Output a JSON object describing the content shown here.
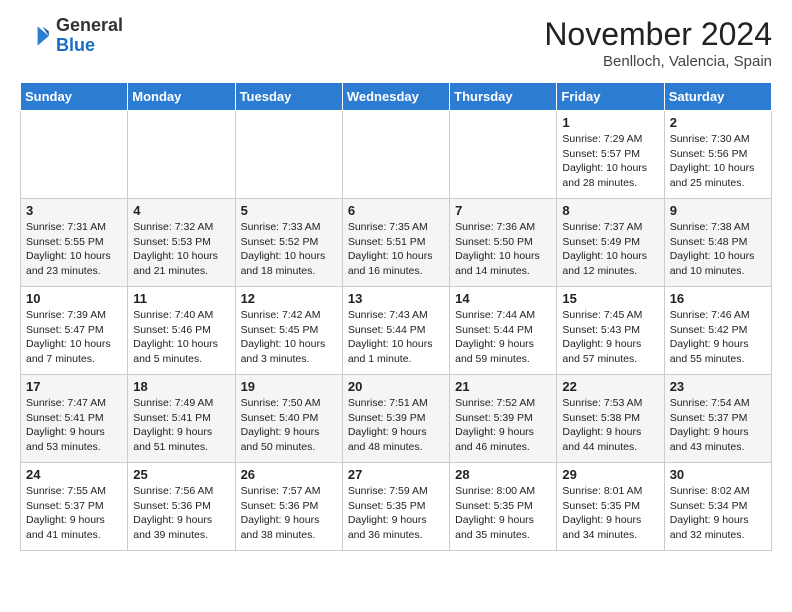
{
  "header": {
    "logo_general": "General",
    "logo_blue": "Blue",
    "month_title": "November 2024",
    "location": "Benlloch, Valencia, Spain"
  },
  "weekdays": [
    "Sunday",
    "Monday",
    "Tuesday",
    "Wednesday",
    "Thursday",
    "Friday",
    "Saturday"
  ],
  "weeks": [
    [
      {
        "day": "",
        "info": ""
      },
      {
        "day": "",
        "info": ""
      },
      {
        "day": "",
        "info": ""
      },
      {
        "day": "",
        "info": ""
      },
      {
        "day": "",
        "info": ""
      },
      {
        "day": "1",
        "info": "Sunrise: 7:29 AM\nSunset: 5:57 PM\nDaylight: 10 hours and 28 minutes."
      },
      {
        "day": "2",
        "info": "Sunrise: 7:30 AM\nSunset: 5:56 PM\nDaylight: 10 hours and 25 minutes."
      }
    ],
    [
      {
        "day": "3",
        "info": "Sunrise: 7:31 AM\nSunset: 5:55 PM\nDaylight: 10 hours and 23 minutes."
      },
      {
        "day": "4",
        "info": "Sunrise: 7:32 AM\nSunset: 5:53 PM\nDaylight: 10 hours and 21 minutes."
      },
      {
        "day": "5",
        "info": "Sunrise: 7:33 AM\nSunset: 5:52 PM\nDaylight: 10 hours and 18 minutes."
      },
      {
        "day": "6",
        "info": "Sunrise: 7:35 AM\nSunset: 5:51 PM\nDaylight: 10 hours and 16 minutes."
      },
      {
        "day": "7",
        "info": "Sunrise: 7:36 AM\nSunset: 5:50 PM\nDaylight: 10 hours and 14 minutes."
      },
      {
        "day": "8",
        "info": "Sunrise: 7:37 AM\nSunset: 5:49 PM\nDaylight: 10 hours and 12 minutes."
      },
      {
        "day": "9",
        "info": "Sunrise: 7:38 AM\nSunset: 5:48 PM\nDaylight: 10 hours and 10 minutes."
      }
    ],
    [
      {
        "day": "10",
        "info": "Sunrise: 7:39 AM\nSunset: 5:47 PM\nDaylight: 10 hours and 7 minutes."
      },
      {
        "day": "11",
        "info": "Sunrise: 7:40 AM\nSunset: 5:46 PM\nDaylight: 10 hours and 5 minutes."
      },
      {
        "day": "12",
        "info": "Sunrise: 7:42 AM\nSunset: 5:45 PM\nDaylight: 10 hours and 3 minutes."
      },
      {
        "day": "13",
        "info": "Sunrise: 7:43 AM\nSunset: 5:44 PM\nDaylight: 10 hours and 1 minute."
      },
      {
        "day": "14",
        "info": "Sunrise: 7:44 AM\nSunset: 5:44 PM\nDaylight: 9 hours and 59 minutes."
      },
      {
        "day": "15",
        "info": "Sunrise: 7:45 AM\nSunset: 5:43 PM\nDaylight: 9 hours and 57 minutes."
      },
      {
        "day": "16",
        "info": "Sunrise: 7:46 AM\nSunset: 5:42 PM\nDaylight: 9 hours and 55 minutes."
      }
    ],
    [
      {
        "day": "17",
        "info": "Sunrise: 7:47 AM\nSunset: 5:41 PM\nDaylight: 9 hours and 53 minutes."
      },
      {
        "day": "18",
        "info": "Sunrise: 7:49 AM\nSunset: 5:41 PM\nDaylight: 9 hours and 51 minutes."
      },
      {
        "day": "19",
        "info": "Sunrise: 7:50 AM\nSunset: 5:40 PM\nDaylight: 9 hours and 50 minutes."
      },
      {
        "day": "20",
        "info": "Sunrise: 7:51 AM\nSunset: 5:39 PM\nDaylight: 9 hours and 48 minutes."
      },
      {
        "day": "21",
        "info": "Sunrise: 7:52 AM\nSunset: 5:39 PM\nDaylight: 9 hours and 46 minutes."
      },
      {
        "day": "22",
        "info": "Sunrise: 7:53 AM\nSunset: 5:38 PM\nDaylight: 9 hours and 44 minutes."
      },
      {
        "day": "23",
        "info": "Sunrise: 7:54 AM\nSunset: 5:37 PM\nDaylight: 9 hours and 43 minutes."
      }
    ],
    [
      {
        "day": "24",
        "info": "Sunrise: 7:55 AM\nSunset: 5:37 PM\nDaylight: 9 hours and 41 minutes."
      },
      {
        "day": "25",
        "info": "Sunrise: 7:56 AM\nSunset: 5:36 PM\nDaylight: 9 hours and 39 minutes."
      },
      {
        "day": "26",
        "info": "Sunrise: 7:57 AM\nSunset: 5:36 PM\nDaylight: 9 hours and 38 minutes."
      },
      {
        "day": "27",
        "info": "Sunrise: 7:59 AM\nSunset: 5:35 PM\nDaylight: 9 hours and 36 minutes."
      },
      {
        "day": "28",
        "info": "Sunrise: 8:00 AM\nSunset: 5:35 PM\nDaylight: 9 hours and 35 minutes."
      },
      {
        "day": "29",
        "info": "Sunrise: 8:01 AM\nSunset: 5:35 PM\nDaylight: 9 hours and 34 minutes."
      },
      {
        "day": "30",
        "info": "Sunrise: 8:02 AM\nSunset: 5:34 PM\nDaylight: 9 hours and 32 minutes."
      }
    ]
  ]
}
